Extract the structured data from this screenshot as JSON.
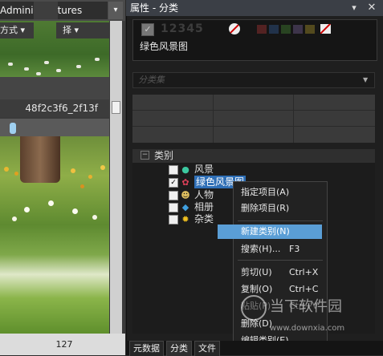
{
  "left_pane": {
    "path_text": "Admini",
    "path_text_2": "tures",
    "menu_view": "方式 ▾",
    "menu_select": "择 ▾",
    "file_name": "48f2c3f6_2f13f",
    "bottom_value": "127"
  },
  "panel": {
    "title": "属性 - 分类",
    "pin_icon": "▾",
    "close_icon": "✕",
    "rating_digits": "12345",
    "photo_label": "绿色风景图",
    "category_set_placeholder": "分类集",
    "color_labels": [
      "#c83c3c",
      "#3a6ab0",
      "#4e9a3a",
      "#8a6fb0",
      "#c8b030",
      "#3c3c3c"
    ],
    "tree": {
      "title": "类别",
      "items": [
        {
          "label": "风景",
          "checked": false,
          "icon": "globe-icon"
        },
        {
          "label": "绿色风景图",
          "checked": true,
          "icon": "flower-icon"
        },
        {
          "label": "人物",
          "checked": false,
          "icon": "people-icon"
        },
        {
          "label": "相册",
          "checked": false,
          "icon": "album-icon"
        },
        {
          "label": "杂类",
          "checked": false,
          "icon": "sun-icon"
        }
      ]
    },
    "tabs": [
      "元数据",
      "分类",
      "文件"
    ]
  },
  "context_menu": {
    "items": [
      {
        "label": "指定项目(A)",
        "shortcut": ""
      },
      {
        "label": "删除项目(R)",
        "shortcut": ""
      },
      {
        "label": "新建类别(N)",
        "shortcut": ""
      },
      {
        "label": "搜索(H)...",
        "shortcut": "F3"
      },
      {
        "label": "剪切(U)",
        "shortcut": "Ctrl+X"
      },
      {
        "label": "复制(O)",
        "shortcut": "Ctrl+C"
      },
      {
        "label": "粘贴(P)",
        "shortcut": "Ctrl+V"
      },
      {
        "label": "删除(D)",
        "shortcut": ""
      },
      {
        "label": "编辑类别(E)",
        "shortcut": ""
      }
    ]
  },
  "watermark": {
    "text": "当下软件园",
    "url": "www.downxia.com"
  }
}
